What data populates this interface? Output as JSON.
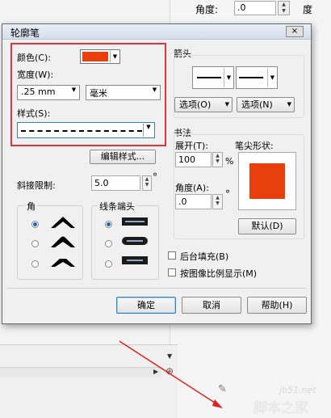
{
  "background": {
    "angle_label": "角度:",
    "angle_value": ".0",
    "angle_unit": "度",
    "watermark_site": "jb51.net",
    "watermark_name": "脚本之家"
  },
  "dialog": {
    "title": "轮廓笔",
    "color_label": "颜色(C):",
    "width_label": "宽度(W):",
    "width_value": ".25 mm",
    "unit_value": "毫米",
    "style_label": "样式(S):",
    "edit_style_button": "编辑样式...",
    "miter_label": "斜接限制:",
    "miter_value": "5.0",
    "miter_unit": "°",
    "corner_label": "角",
    "linecap_label": "线条端头",
    "arrows_label": "箭头",
    "option_left": "选项(O)",
    "option_right": "选项(N)",
    "calligraphy_label": "书法",
    "stretch_label": "展开(T):",
    "stretch_value": "100",
    "stretch_unit": "%",
    "nib_shape_label": "笔尖形状:",
    "angle_label": "角度(A):",
    "angle_value": ".0",
    "angle_unit": "°",
    "default_button": "默认(D)",
    "behind_fill_label": "后台填充(B)",
    "scale_with_image_label": "按图像比例显示(M)",
    "ok_button": "确定",
    "cancel_button": "取消",
    "help_button": "帮助(H)",
    "close_glyph": "×"
  },
  "colors": {
    "outline_color": "#e8400c",
    "highlight": "#d9363e",
    "arrow_annotation": "#e02020"
  }
}
